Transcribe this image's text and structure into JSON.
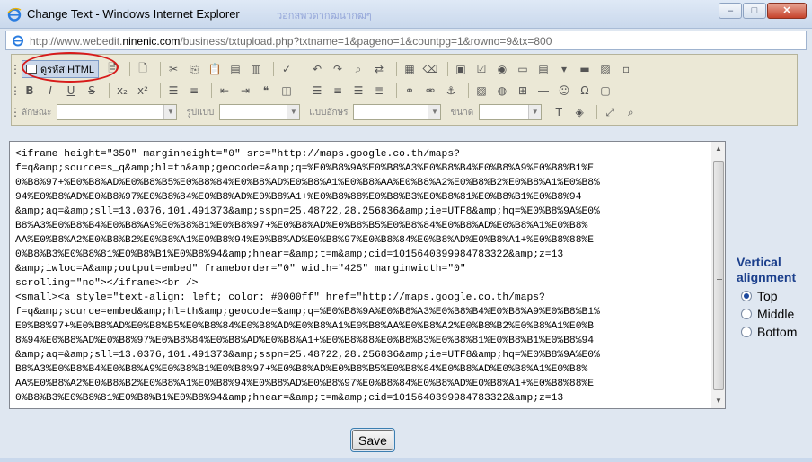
{
  "window": {
    "title": "Change Text - Windows Internet Explorer",
    "faint_title": "วอกสพวดากฒนากฒๆ",
    "minimize_label": "–",
    "maximize_label": "□",
    "close_label": "✕"
  },
  "address": {
    "prefix": "http://www.webedit.",
    "domain": "ninenic.com",
    "path": "/business/txtupload.php?txtname=1&pageno=1&countpg=1&rowno=9&tx=800"
  },
  "toolbar": {
    "html_button_label": "ดูรหัส HTML",
    "combos": [
      {
        "label": "ลักษณะ",
        "value": ""
      },
      {
        "label": "รูปแบบ",
        "value": ""
      },
      {
        "label": "แบบอักษร",
        "value": ""
      },
      {
        "label": "ขนาด",
        "value": ""
      }
    ],
    "row1_icons": [
      "new-page-icon",
      "cut-icon",
      "copy-icon",
      "paste-icon",
      "paste-text-icon",
      "paste-word-icon",
      "spellcheck-icon",
      "undo-icon",
      "redo-icon",
      "find-icon",
      "replace-icon",
      "select-all-icon",
      "remove-format-icon",
      "form-icon",
      "checkbox-icon",
      "radio-icon",
      "textfield-icon",
      "textarea-icon",
      "select-icon",
      "button-icon",
      "image-button-icon",
      "hidden-field-icon"
    ],
    "row2_icons": [
      "bold-icon",
      "italic-icon",
      "underline-icon",
      "strike-icon",
      "subscript-icon",
      "superscript-icon",
      "ordered-list-icon",
      "unordered-list-icon",
      "outdent-icon",
      "indent-icon",
      "blockquote-icon",
      "div-icon",
      "align-left-icon",
      "align-center-icon",
      "align-right-icon",
      "justify-icon",
      "link-icon",
      "unlink-icon",
      "anchor-icon",
      "image-icon",
      "flash-icon",
      "table-icon",
      "hr-icon",
      "smiley-icon",
      "special-char-icon",
      "iframe-icon"
    ]
  },
  "editor": {
    "code_lines": [
      "<iframe height=\"350\" marginheight=\"0\" src=\"http://maps.google.co.th/maps?",
      "f=q&amp;source=s_q&amp;hl=th&amp;geocode=&amp;q=%E0%B8%9A%E0%B8%A3%E0%B8%B4%E0%B8%A9%E0%B8%B1%E",
      "0%B8%97+%E0%B8%AD%E0%B8%B5%E0%B8%84%E0%B8%AD%E0%B8%A1%E0%B8%AA%E0%B8%A2%E0%B8%B2%E0%B8%A1%E0%B8%",
      "94%E0%B8%AD%E0%B8%97%E0%B8%84%E0%B8%AD%E0%B8%A1+%E0%B8%88%E0%B8%B3%E0%B8%81%E0%B8%B1%E0%B8%94",
      "&amp;aq=&amp;sll=13.0376,101.491373&amp;sspn=25.48722,28.256836&amp;ie=UTF8&amp;hq=%E0%B8%9A%E0%",
      "B8%A3%E0%B8%B4%E0%B8%A9%E0%B8%B1%E0%B8%97+%E0%B8%AD%E0%B8%B5%E0%B8%84%E0%B8%AD%E0%B8%A1%E0%B8%",
      "AA%E0%B8%A2%E0%B8%B2%E0%B8%A1%E0%B8%94%E0%B8%AD%E0%B8%97%E0%B8%84%E0%B8%AD%E0%B8%A1+%E0%B8%88%E",
      "0%B8%B3%E0%B8%81%E0%B8%B1%E0%B8%94&amp;hnear=&amp;t=m&amp;cid=1015640399984783322&amp;z=13",
      "&amp;iwloc=A&amp;output=embed\" frameborder=\"0\" width=\"425\" marginwidth=\"0\"",
      "scrolling=\"no\"></iframe><br />",
      "<small><a style=\"text-align: left; color: #0000ff\" href=\"http://maps.google.co.th/maps?",
      "f=q&amp;source=embed&amp;hl=th&amp;geocode=&amp;q=%E0%B8%9A%E0%B8%A3%E0%B8%B4%E0%B8%A9%E0%B8%B1%",
      "E0%B8%97+%E0%B8%AD%E0%B8%B5%E0%B8%84%E0%B8%AD%E0%B8%A1%E0%B8%AA%E0%B8%A2%E0%B8%B2%E0%B8%A1%E0%B",
      "8%94%E0%B8%AD%E0%B8%97%E0%B8%84%E0%B8%AD%E0%B8%A1+%E0%B8%88%E0%B8%B3%E0%B8%81%E0%B8%B1%E0%B8%94",
      "&amp;aq=&amp;sll=13.0376,101.491373&amp;sspn=25.48722,28.256836&amp;ie=UTF8&amp;hq=%E0%B8%9A%E0%",
      "B8%A3%E0%B8%B4%E0%B8%A9%E0%B8%B1%E0%B8%97+%E0%B8%AD%E0%B8%B5%E0%B8%84%E0%B8%AD%E0%B8%A1%E0%B8%",
      "AA%E0%B8%A2%E0%B8%B2%E0%B8%A1%E0%B8%94%E0%B8%AD%E0%B8%97%E0%B8%84%E0%B8%AD%E0%B8%A1+%E0%B8%88%E",
      "0%B8%B3%E0%B8%81%E0%B8%B1%E0%B8%94&amp;hnear=&amp;t=m&amp;cid=1015640399984783322&amp;z=13"
    ]
  },
  "vertical_alignment": {
    "title_line1": "Vertical",
    "title_line2": "alignment",
    "options": [
      {
        "label": "Top",
        "checked": true
      },
      {
        "label": "Middle",
        "checked": false
      },
      {
        "label": "Bottom",
        "checked": false
      }
    ]
  },
  "save_label": "Save",
  "colors": {
    "accent": "#1b3f8c",
    "highlight_ring": "#d71a1a"
  }
}
